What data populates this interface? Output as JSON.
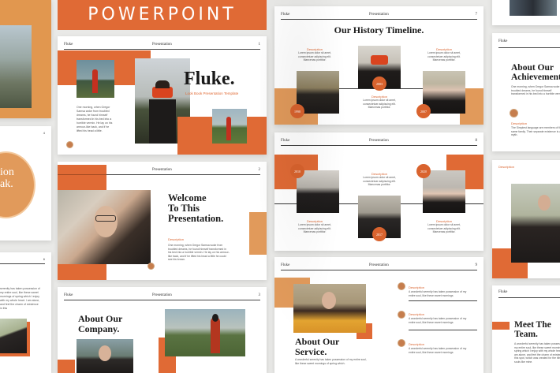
{
  "colors": {
    "orange": "#e06a35",
    "tan": "#e19a5b",
    "bg": "#e9e9e7"
  },
  "banner": {
    "title": "POWERPOINT"
  },
  "cover": {
    "brand": "Fluke",
    "header": "Presentation",
    "num": "1",
    "title": "Fluke.",
    "subtitle": "Look Book Presentation Template",
    "body": "One morning, when Gregor Samsa woke from troubled dreams, he found himself transformed in his bed into a horrible vermin. He lay on his armour-like back, and if he lifted his head a little."
  },
  "welcome": {
    "brand": "Fluke",
    "header": "Presentation",
    "num": "2",
    "title_l1": "Welcome",
    "title_l2": "To This",
    "title_l3": "Presentation.",
    "desc_h": "Description",
    "desc_t": "One morning, when Gregor Samsa woke from troubled dreams, he found himself transformed in his bed into a horrible vermin. He lay on his armour-like back, and if he lifted his head a little he could see his brown."
  },
  "company": {
    "brand": "Fluke",
    "header": "Presentation",
    "num": "3",
    "title_l1": "About Our",
    "title_l2": "Company."
  },
  "timeline1": {
    "brand": "Fluke",
    "header": "Presentation",
    "num": "7",
    "title": "Our History Timeline.",
    "items": [
      {
        "h": "Description",
        "t": "Lorem ipsum dolor sit amet, consectetuer adipiscing elit. Maecenas porttitor."
      },
      {
        "h": "Description",
        "t": "Lorem ipsum dolor sit amet, consectetuer adipiscing elit. Maecenas porttitor."
      },
      {
        "h": "Description",
        "t": "Lorem ipsum dolor sit amet, consectetuer adipiscing elit. Maecenas porttitor."
      }
    ],
    "years": [
      "1998",
      "2003",
      "2007"
    ]
  },
  "timeline2": {
    "brand": "Fluke",
    "header": "Presentation",
    "num": "8",
    "items": [
      {
        "h": "Description",
        "t": "Lorem ipsum dolor sit amet, consectetuer adipiscing elit. Maecenas porttitor."
      },
      {
        "h": "Description",
        "t": "Lorem ipsum dolor sit amet, consectetuer adipiscing elit. Maecenas porttitor."
      },
      {
        "h": "Description",
        "t": "Lorem ipsum dolor sit amet, consectetuer adipiscing elit. Maecenas porttitor."
      }
    ],
    "years": [
      "2010",
      "2017",
      "2020"
    ]
  },
  "service": {
    "brand": "Fluke",
    "header": "Presentation",
    "num": "9",
    "title_l1": "About Our",
    "title_l2": "Service.",
    "body": "A wonderful serenity has taken possession of my entire soul, like these sweet mornings of spring which.",
    "items": [
      {
        "h": "Description",
        "t": "A wonderful serenity has taken possession of my entire soul, like these sweet mornings"
      },
      {
        "h": "Description",
        "t": "A wonderful serenity has taken possession of my entire soul, like these sweet mornings"
      },
      {
        "h": "Description",
        "t": "A wonderful serenity has taken possession of my entire soul, like these sweet mornings"
      }
    ]
  },
  "right_col": {
    "achieve_brand": "Fluke",
    "achieve_title_l1": "About Our",
    "achieve_title_l2": "Achievement",
    "achieve_body": "One morning, when Gregor Samsa woke from troubled dreams, he found himself transformed in his bed into a horrible vermin.",
    "achieve_desc_h": "Description",
    "achieve_desc_t": "The Simplest language are members of the same family. Their separate existence is a myth.",
    "team_brand": "Fluke",
    "team_title_l1": "Meet The",
    "team_title_l2": "Team.",
    "team_body": "A wonderful serenity has taken possession of my entire soul, like these sweet mornings of spring which I enjoy with my whole heart. I am alone, and feel the charm of existence in this spot, which was created for the bliss of souls like mine."
  },
  "left_col": {
    "circle_l1": "ion",
    "circle_l2": "ak.",
    "num": "4",
    "num2": "6",
    "body": "serenity has taken possession of my entire soul, like these sweet mornings of spring which I enjoy with my whole heart. I am alone, and feel the charm of existence in this"
  }
}
